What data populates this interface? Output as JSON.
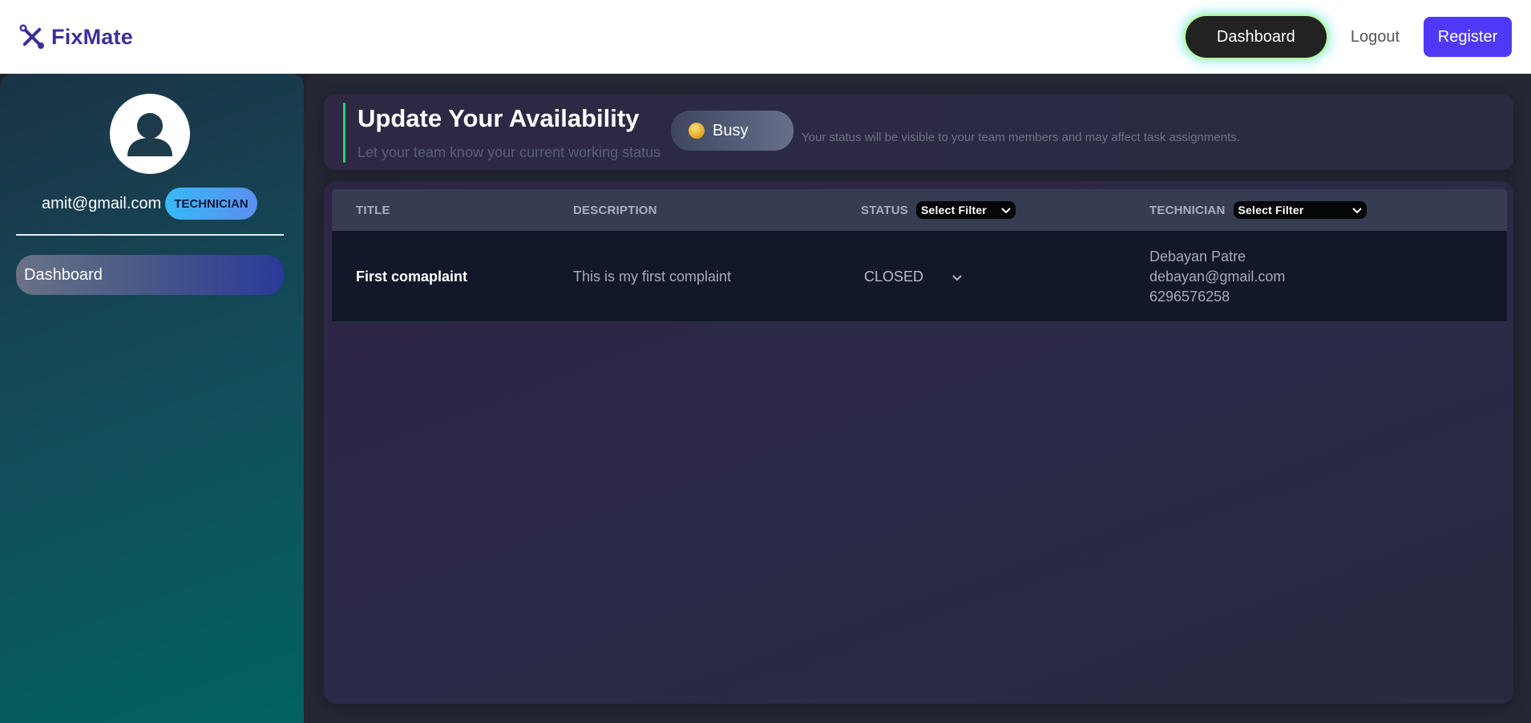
{
  "brand": {
    "name": "FixMate",
    "icon": "wrench-screwdriver-icon",
    "color": "#3b2f9c"
  },
  "navbar": {
    "dashboard_label": "Dashboard",
    "logout_label": "Logout",
    "register_label": "Register",
    "register_color": "#4f39f6"
  },
  "sidebar": {
    "avatar_icon": "user-avatar-icon",
    "email": "amit@gmail.com",
    "role": "TECHNICIAN",
    "items": [
      {
        "label": "Dashboard",
        "active": true
      }
    ]
  },
  "availability": {
    "title": "Update Your Availability",
    "subtitle": "Let your team know your current working status",
    "status_label": "Busy",
    "status_color": "#e8b43a",
    "note": "Your status will be visible to your team members and may affect task assignments."
  },
  "table": {
    "headers": {
      "title": "TITLE",
      "description": "DESCRIPTION",
      "status": "STATUS",
      "technician": "TECHNICIAN"
    },
    "status_filter": "Select Filter",
    "technician_filter": "Select Filter",
    "rows": [
      {
        "title": "First comaplaint",
        "description": "This is my first complaint",
        "status": "CLOSED",
        "technician_name": "Debayan Patre",
        "technician_email": "debayan@gmail.com",
        "technician_phone": "6296576258"
      }
    ]
  }
}
